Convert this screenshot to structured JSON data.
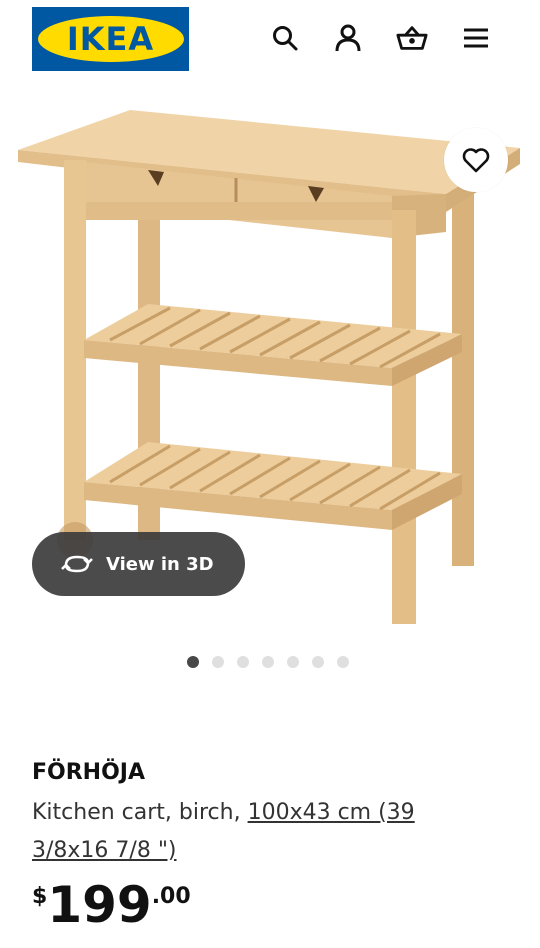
{
  "header": {
    "logo_text": "IKEA",
    "icons": [
      "search-icon",
      "account-icon",
      "basket-icon",
      "menu-icon"
    ]
  },
  "gallery": {
    "view_3d_label": "View in 3D",
    "dots_count": 7,
    "active_dot": 1
  },
  "product": {
    "name": "FÖRHÖJA",
    "description": "Kitchen cart, birch, ",
    "dimensions_link": "100x43 cm (39 3/8x16 7/8 \")",
    "price_currency": "$",
    "price_integer": "199",
    "price_decimal": ".00"
  },
  "colors": {
    "ikea_blue": "#0058A3",
    "ikea_yellow": "#FFDB00",
    "birch": "#E9C99A"
  }
}
